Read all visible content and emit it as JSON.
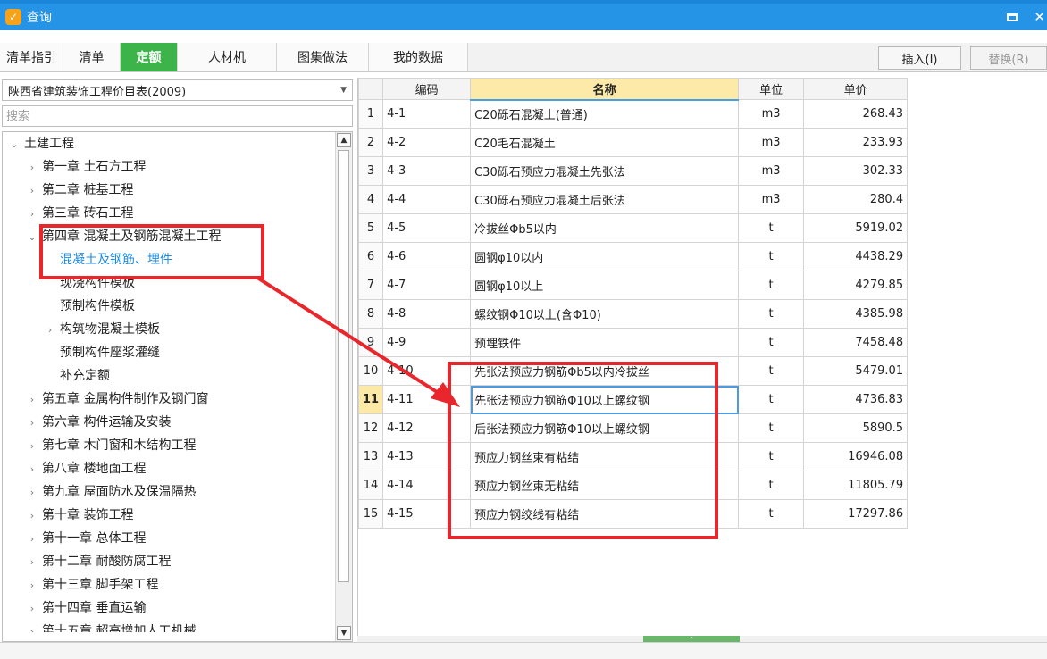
{
  "window": {
    "title": "查询",
    "icon": "app-logo-icon"
  },
  "tabs": [
    {
      "label": "清单指引",
      "active": false
    },
    {
      "label": "清单",
      "active": false
    },
    {
      "label": "定额",
      "active": true
    },
    {
      "label": "人材机",
      "active": false
    },
    {
      "label": "图集做法",
      "active": false
    },
    {
      "label": "我的数据",
      "active": false
    }
  ],
  "buttons": {
    "insert": "插入(I)",
    "replace": "替换(R)"
  },
  "library": {
    "selected": "陕西省建筑装饰工程价目表(2009)"
  },
  "search": {
    "placeholder": "搜索",
    "value": ""
  },
  "tree": [
    {
      "label": "土建工程",
      "level": 0,
      "arrow": "expanded"
    },
    {
      "label": "第一章 土石方工程",
      "level": 1,
      "arrow": "collapsed"
    },
    {
      "label": "第二章 桩基工程",
      "level": 1,
      "arrow": "collapsed"
    },
    {
      "label": "第三章 砖石工程",
      "level": 1,
      "arrow": "collapsed"
    },
    {
      "label": "第四章 混凝土及钢筋混凝土工程",
      "level": 1,
      "arrow": "expanded"
    },
    {
      "label": "混凝土及钢筋、埋件",
      "level": 2,
      "arrow": "none",
      "selected": true
    },
    {
      "label": "现浇构件模板",
      "level": 2,
      "arrow": "none"
    },
    {
      "label": "预制构件模板",
      "level": 2,
      "arrow": "none"
    },
    {
      "label": "构筑物混凝土模板",
      "level": 2,
      "arrow": "collapsed"
    },
    {
      "label": "预制构件座浆灌缝",
      "level": 2,
      "arrow": "none"
    },
    {
      "label": "补充定额",
      "level": 2,
      "arrow": "none"
    },
    {
      "label": "第五章 金属构件制作及钢门窗",
      "level": 1,
      "arrow": "collapsed"
    },
    {
      "label": "第六章 构件运输及安装",
      "level": 1,
      "arrow": "collapsed"
    },
    {
      "label": "第七章 木门窗和木结构工程",
      "level": 1,
      "arrow": "collapsed"
    },
    {
      "label": "第八章 楼地面工程",
      "level": 1,
      "arrow": "collapsed"
    },
    {
      "label": "第九章 屋面防水及保温隔热",
      "level": 1,
      "arrow": "collapsed"
    },
    {
      "label": "第十章 装饰工程",
      "level": 1,
      "arrow": "collapsed"
    },
    {
      "label": "第十一章 总体工程",
      "level": 1,
      "arrow": "collapsed"
    },
    {
      "label": "第十二章 耐酸防腐工程",
      "level": 1,
      "arrow": "collapsed"
    },
    {
      "label": "第十三章 脚手架工程",
      "level": 1,
      "arrow": "collapsed"
    },
    {
      "label": "第十四章 垂直运输",
      "level": 1,
      "arrow": "collapsed"
    },
    {
      "label": "第十五章 超高增加人工机械",
      "level": 1,
      "arrow": "collapsed"
    }
  ],
  "grid": {
    "columns": {
      "code": "编码",
      "name": "名称",
      "unit": "单位",
      "price": "单价"
    },
    "current_row": 11,
    "rows": [
      {
        "n": "1",
        "code": "4-1",
        "name": "C20砾石混凝土(普通)",
        "unit": "m3",
        "price": "268.43"
      },
      {
        "n": "2",
        "code": "4-2",
        "name": "C20毛石混凝土",
        "unit": "m3",
        "price": "233.93"
      },
      {
        "n": "3",
        "code": "4-3",
        "name": "C30砾石预应力混凝土先张法",
        "unit": "m3",
        "price": "302.33"
      },
      {
        "n": "4",
        "code": "4-4",
        "name": "C30砾石预应力混凝土后张法",
        "unit": "m3",
        "price": "280.4"
      },
      {
        "n": "5",
        "code": "4-5",
        "name": "冷拔丝Φb5以内",
        "unit": "t",
        "price": "5919.02"
      },
      {
        "n": "6",
        "code": "4-6",
        "name": "圆钢φ10以内",
        "unit": "t",
        "price": "4438.29"
      },
      {
        "n": "7",
        "code": "4-7",
        "name": "圆钢φ10以上",
        "unit": "t",
        "price": "4279.85"
      },
      {
        "n": "8",
        "code": "4-8",
        "name": "螺纹钢Φ10以上(含Φ10)",
        "unit": "t",
        "price": "4385.98"
      },
      {
        "n": "9",
        "code": "4-9",
        "name": "预埋铁件",
        "unit": "t",
        "price": "7458.48"
      },
      {
        "n": "10",
        "code": "4-10",
        "name": "先张法预应力钢筋Φb5以内冷拔丝",
        "unit": "t",
        "price": "5479.01"
      },
      {
        "n": "11",
        "code": "4-11",
        "name": "先张法预应力钢筋Φ10以上螺纹钢",
        "unit": "t",
        "price": "4736.83"
      },
      {
        "n": "12",
        "code": "4-12",
        "name": "后张法预应力钢筋Φ10以上螺纹钢",
        "unit": "t",
        "price": "5890.5"
      },
      {
        "n": "13",
        "code": "4-13",
        "name": "预应力钢丝束有粘结",
        "unit": "t",
        "price": "16946.08"
      },
      {
        "n": "14",
        "code": "4-14",
        "name": "预应力钢丝束无粘结",
        "unit": "t",
        "price": "11805.79"
      },
      {
        "n": "15",
        "code": "4-15",
        "name": "预应力钢绞线有粘结",
        "unit": "t",
        "price": "17297.86"
      }
    ]
  },
  "colors": {
    "titlebar": "#2593e6",
    "active_tab": "#3cb44a",
    "selected_text": "#1f8ae0",
    "annotation": "#e8262b",
    "header_highlight": "#fdeaa8"
  },
  "icons": {
    "close": "✕",
    "scroll_up": "▲",
    "scroll_down": "▼",
    "splitter": "⌃"
  }
}
